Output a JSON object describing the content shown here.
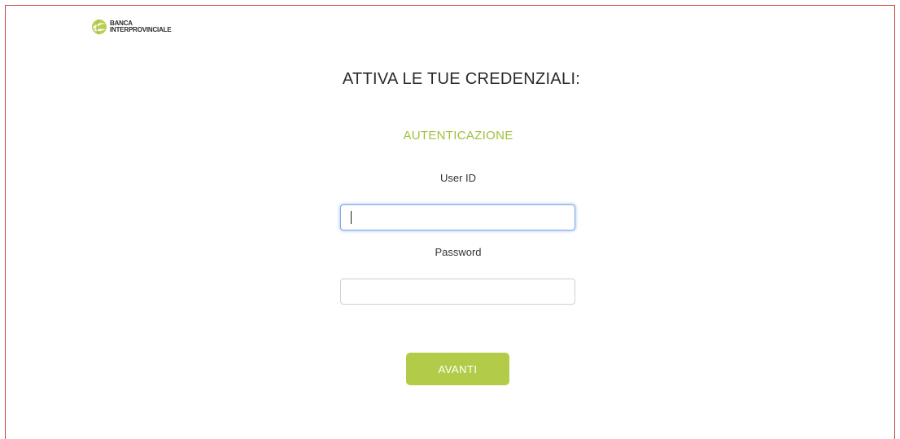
{
  "brand": {
    "line1": "BANCA",
    "line2": "INTERPROVINCIALE",
    "logo_icon": "globe-leaf-icon",
    "accent_color": "#b2cc4a"
  },
  "page": {
    "title": "ATTIVA LE TUE CREDENZIALI:",
    "section_heading": "AUTENTICAZIONE"
  },
  "form": {
    "user_id": {
      "label": "User ID",
      "value": "",
      "focused": true
    },
    "password": {
      "label": "Password",
      "value": ""
    },
    "submit_label": "AVANTI"
  },
  "colors": {
    "frame_border": "#c9413f",
    "section_heading": "#9dc13c",
    "button_bg": "#b2cc4a",
    "focus_ring": "#7fa9e8"
  }
}
